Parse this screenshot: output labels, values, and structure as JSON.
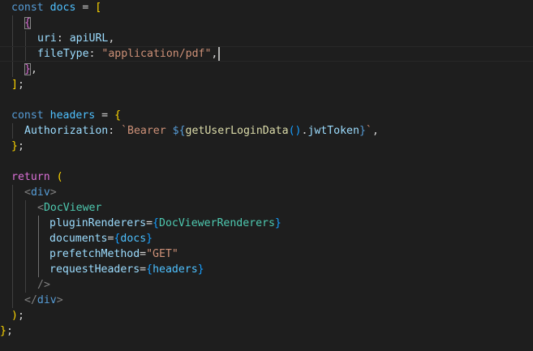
{
  "editor": {
    "language": "javascript",
    "theme": {
      "background": "#1e1e1e",
      "keyword": "#569cd6",
      "const_name": "#4fc1ff",
      "property": "#9cdcfe",
      "string": "#ce9178",
      "function": "#dcdcaa",
      "jsx_component": "#4ec9b0",
      "bracket_level1": "#ffd700",
      "bracket_level2": "#da70d6",
      "bracket_level3": "#179fff"
    },
    "tokens": {
      "const": "const",
      "docs": "docs",
      "eq": " = ",
      "lbrack": "[",
      "rbrack": "]",
      "semi": ";",
      "lbrace": "{",
      "rbrace": "}",
      "comma": ",",
      "uri_key": "uri",
      "colon": ": ",
      "apiURL": "apiURL",
      "fileType_key": "fileType",
      "pdf_string": "\"application/pdf\"",
      "headers": "headers",
      "authorization_key": "Authorization",
      "tpl_start": "`Bearer ",
      "tpl_interp_open": "${",
      "getUserLoginData": "getUserLoginData",
      "call_parens": "()",
      "dot": ".",
      "jwtToken": "jwtToken",
      "tpl_interp_close": "}",
      "tpl_end": "`",
      "return": "return",
      "lparen": "(",
      "rparen": ")",
      "lt": "<",
      "gt": ">",
      "div": "div",
      "close_div_open": "</",
      "DocViewer": "DocViewer",
      "pluginRenderers_attr": "pluginRenderers",
      "attr_eq": "=",
      "DocViewerRenderers": "DocViewerRenderers",
      "documents_attr": "documents",
      "prefetchMethod_attr": "prefetchMethod",
      "get_string": "\"GET\"",
      "requestHeaders_attr": "requestHeaders",
      "self_close": "/>",
      "final_close": "};"
    }
  }
}
